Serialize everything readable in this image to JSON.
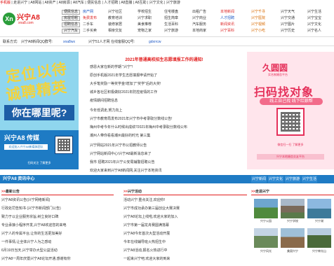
{
  "topstrip": {
    "links": [
      "手机版",
      "|",
      "走进兴宁",
      "|",
      "A8网站",
      "|",
      "A8资产",
      "|",
      "A8房源",
      "|",
      "A8汽车",
      "|",
      "便民信息",
      "|",
      "人才招聘",
      "|",
      "A8直播",
      "|",
      "A8互助",
      "|",
      "兴宁文化",
      "|",
      "兴宁旅游"
    ]
  },
  "logo": {
    "glyph": "Xn",
    "name": "兴宁A8",
    "url": "xna8.com"
  },
  "nav": {
    "rows": [
      {
        "head": "便民信息",
        "cells": [
          "房产网",
          "兴宁社区",
          "学校招生",
          "住宅楼盘",
          "出租广告",
          "本地新闻",
          "兴宁千寻",
          "兴宁天气",
          "兴宁生活"
        ]
      },
      {
        "head": "房屋招租",
        "cells": [
          "免费发布",
          "教育培训",
          "兴宁求职",
          "招生简章",
          "兴宁商业",
          "人才招聘",
          "兴宁医院",
          "兴宁交通",
          "兴宁宝宝"
        ]
      },
      {
        "head": "招聘信息",
        "cells": [
          "二手车",
          "装修家居",
          "美食推荐",
          "生活百科",
          "汽车服务",
          "新闻资讯",
          "兴宁视频",
          "兴宁图片",
          "兴宁文化"
        ]
      },
      {
        "head": "兴宁汽车",
        "cells": [
          "二手买卖",
          "相亲交友",
          "宠物之家",
          "兴宁旅游",
          "本地商家",
          "兴宁百科",
          "兴宁小吃",
          "兴宁历史",
          "兴宁名人"
        ]
      }
    ]
  },
  "searchbar": {
    "label1": "联系方式:",
    "text1": "兴宁A8新闻QQ群号:",
    "link1": "xna8wx",
    "text2": "兴宁51人才网 在线客服QQ号:",
    "link2": "gdxrrcw"
  },
  "leftbanner": {
    "title1": "定位以待",
    "title2": "诚聘精英",
    "sub": "你在哪里呢?",
    "brand": "兴宁A8 传媒",
    "note": "欢迎加入兴宁A8新媒体团队",
    "foot": "扫码关注 了解更多"
  },
  "news": {
    "headline": "2021年普通高校招生志愿填报工作的通知!",
    "items": [
      "感恩大家在新的学期 \"兴宁\"!",
      "原创手机版2021年学生志愿填报申请开始了",
      "大手笔奖励一等奖学金!增加了\"奖学\"后的大奖!",
      "城乡各社区积极做好2021年防控疫情的工作",
      "疫情期间招聘信息",
      "今年低调走,努力向上",
      "兴宁市教育局发布2021年兴宁市中考录取分数线公告!",
      "梅州中考今年什么时候出成绩?2021年梅州中考录取分数线公布",
      "潮州人带你看看潮州最好的时光 第三集",
      "兴宁网站2021年兴宁市公招教师公告",
      "兴宁网站新闻中心!兴宁A8最新消息来了",
      "我市 招聘2021年兴宁公安局辅警招聘公告",
      "欢迎大家来到兴宁A8新闻网,关注兴宁本地资讯"
    ]
  },
  "rightad": {
    "logo": "久圆圆",
    "logosub": "实名制婚恋平台",
    "main": "扫码找对象",
    "bar": "线上自己找 线下红娘帮",
    "foot1": "微信扫一扫 了解更多",
    "foot2": "兴宁本地婚恋交友平台"
  },
  "bluestrip": {
    "title": "兴宁A8 资讯中心",
    "tabs": [
      "兴宁新闻",
      "兴宁文化",
      "兴宁旅游",
      "兴宁生活"
    ]
  },
  "cols": {
    "col1": {
      "head": "最新公告",
      "items": [
        "兴宁A8资讯公告(兴宁网络新闻)",
        "行政处罚告知书 (兴宁市新闻部门公告)",
        "致力于以企业服务宗旨,树立良好口碑",
        "专业承接小程序开发,兴宁A8欢迎您的来电",
        "兴宁人的专属平台,让你的生活更加美好",
        "一件事情,让全体兴宁人为之感动",
        "6月19日当天,兴宁举办大型公益活动",
        "兴宁A8一周年庆暨兴宁A8论坛开通,感谢有你"
      ]
    },
    "col2": {
      "head": "兴宁活动",
      "items": [
        "活动兴宁:重点关注,欢迎你!",
        "兴宁市成功承办第三届创业大赛决赛",
        "兴宁A8论坛上线啦,欢迎大家的加入",
        "兴宁市第一届龙舟赛圆满落幕",
        "兴宁A8今年首次大型活动开展",
        "今年在线辅导班火热招生中",
        "兴宁A8活动,报名火热进行中",
        "一起来兴宁吧,欢迎大家的到来"
      ]
    },
    "col3": {
      "head": "走进兴宁",
      "photos": [
        "兴宁公园",
        "兴宁学校",
        "兴宁湖",
        "兴宁风光",
        "美丽兴宁",
        "兴宁神光山"
      ]
    }
  }
}
